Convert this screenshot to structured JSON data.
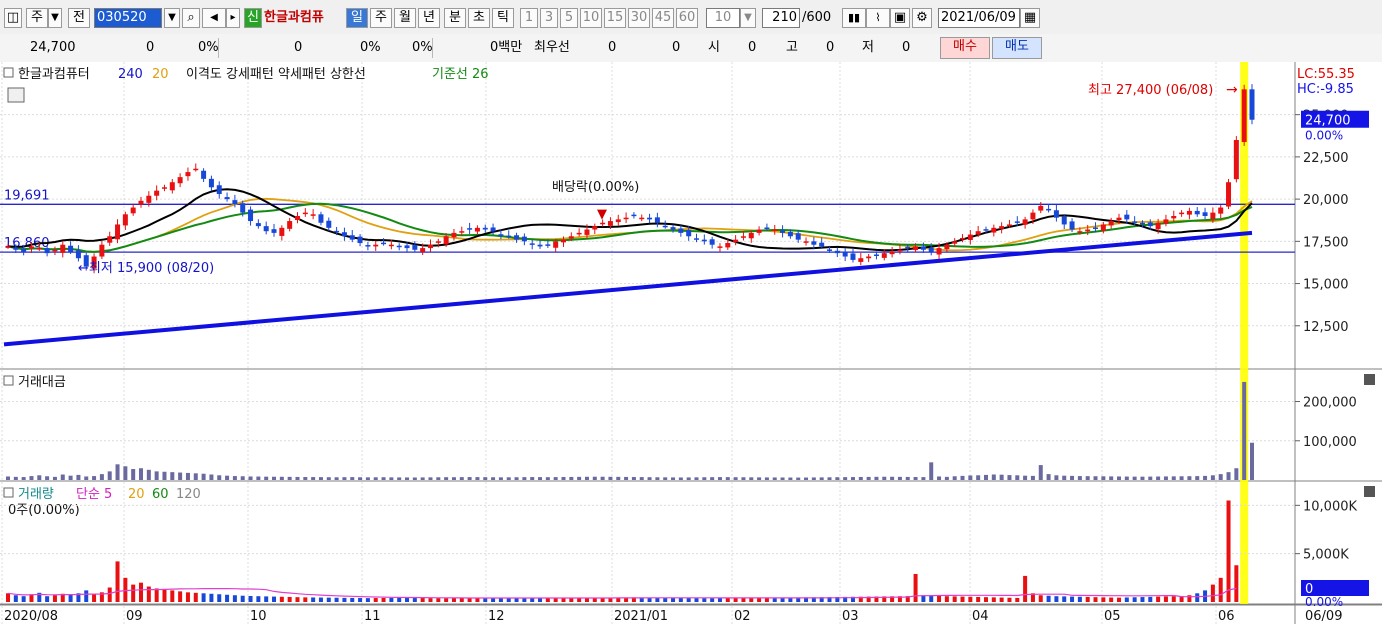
{
  "toolbar": {
    "mode_label": "주",
    "prev_label": "전",
    "code": "030520",
    "badge_label": "신",
    "stock_name": "한글과컴퓨",
    "period_tabs": [
      "일",
      "주",
      "월",
      "년",
      "분",
      "초",
      "틱"
    ],
    "active_period": "일",
    "intervals": [
      "1",
      "3",
      "5",
      "10",
      "15",
      "30",
      "45",
      "60"
    ],
    "interval_value": "10",
    "count_value": "210",
    "count_total": "/600",
    "date": "2021/06/09"
  },
  "quote": {
    "price": "24,700",
    "change": "0",
    "change_pct": "0%",
    "volume": "0",
    "vol_pct": "0%",
    "turnover_pct": "0%",
    "amount": "0백만",
    "priority_label": "최우선",
    "priority_value": "0",
    "field2": "0",
    "open_label": "시",
    "open_value": "0",
    "high_label": "고",
    "high_value": "0",
    "low_label": "저",
    "low_value": "0",
    "buy_label": "매수",
    "sell_label": "매도"
  },
  "colors": {
    "up": "#e81010",
    "down": "#1848d8",
    "ma5": "#e040d0",
    "ma20": "#e0a010",
    "ma60": "#138a13",
    "ma120": "#000000",
    "trend": "#1010e0",
    "highlight": "#ffff00",
    "price_label_bg": "#1414e6"
  },
  "chart_data": [
    {
      "type": "candlestick",
      "legend": {
        "name": "한글과컴퓨터",
        "ma1": "240",
        "ma2": "20",
        "items": "이격도 강세패턴  약세패턴  상한선",
        "base_line": "기준선 26"
      },
      "y_ticks": [
        "25,000",
        "22,500",
        "20,000",
        "17,500",
        "15,000",
        "12,500"
      ],
      "ylim": [
        10000,
        28000
      ],
      "x_ticks": [
        "2020/08",
        "09",
        "10",
        "11",
        "12",
        "2021/01",
        "02",
        "03",
        "04",
        "05",
        "06"
      ],
      "lc_label": "LC:55.35",
      "hc_label": "HC:-9.85",
      "current_price": "24,700",
      "current_value": 24700,
      "current_pct": "0.00%",
      "high_annotation": "최고 27,400 (06/08)",
      "high_value": 27400,
      "low_annotation": "최저 15,900 (08/20)",
      "low_value": 15900,
      "dividend_annotation": "배당락(0.00%)",
      "h_line_1": "19,691",
      "h_line_1_value": 19691,
      "h_line_2": "16,860",
      "h_line_2_value": 16860,
      "trend_start": 11400,
      "trend_end": 18000,
      "closes": [
        17200,
        17000,
        16900,
        17200,
        17100,
        16800,
        17000,
        17300,
        16900,
        16500,
        16000,
        16600,
        17300,
        17800,
        18500,
        19100,
        19500,
        19900,
        20200,
        20500,
        20700,
        21000,
        21300,
        21600,
        21800,
        21200,
        20700,
        20300,
        20000,
        19700,
        19200,
        18700,
        18400,
        18100,
        18000,
        18300,
        18700,
        19000,
        19200,
        19100,
        18600,
        18300,
        18100,
        17800,
        17600,
        17400,
        17200,
        17300,
        17400,
        17300,
        17200,
        17100,
        17000,
        17100,
        17300,
        17500,
        17800,
        18000,
        18100,
        18200,
        18300,
        18200,
        18100,
        17900,
        17800,
        17600,
        17500,
        17300,
        17200,
        17300,
        17500,
        17600,
        17800,
        18000,
        18200,
        18400,
        18600,
        18700,
        18800,
        18900,
        19000,
        18900,
        18800,
        18600,
        18400,
        18200,
        18000,
        17800,
        17600,
        17500,
        17300,
        17200,
        17400,
        17600,
        17800,
        18000,
        18200,
        18300,
        18200,
        18000,
        17800,
        17600,
        17500,
        17300,
        17200,
        17000,
        16800,
        16600,
        16400,
        16500,
        16600,
        16700,
        16800,
        16900,
        17000,
        17100,
        17200,
        17000,
        16900,
        17100,
        17300,
        17500,
        17700,
        17900,
        18100,
        18200,
        18300,
        18400,
        18500,
        18600,
        18800,
        19200,
        19600,
        19400,
        18900,
        18500,
        18200,
        18100,
        18200,
        18300,
        18500,
        18700,
        18900,
        18800,
        18600,
        18500,
        18400,
        18600,
        18800,
        19000,
        19200,
        19300,
        19100,
        19000,
        19200,
        19500,
        21000,
        23500,
        26500,
        24700
      ],
      "volume_panel": {
        "title": "거래대금",
        "y_ticks": [
          "200,000",
          "100,000"
        ],
        "ymax": 260000,
        "values": [
          9000,
          8000,
          7500,
          10000,
          12000,
          9500,
          8000,
          14000,
          11000,
          13000,
          9000,
          10000,
          15000,
          22000,
          40000,
          35000,
          28000,
          30000,
          26000,
          22000,
          21000,
          20000,
          19000,
          18000,
          17000,
          16000,
          14000,
          12000,
          11000,
          10000,
          9500,
          9000,
          8800,
          8500,
          8300,
          8200,
          8000,
          7800,
          7600,
          7500,
          7300,
          7100,
          7000,
          7200,
          7400,
          7000,
          6800,
          6900,
          7100,
          6700,
          6600,
          6500,
          6400,
          6600,
          6800,
          7000,
          7200,
          7100,
          7300,
          7500,
          7400,
          7200,
          7000,
          6800,
          6900,
          7100,
          7300,
          7500,
          7300,
          7200,
          7400,
          7600,
          7800,
          8000,
          8200,
          8400,
          8300,
          8100,
          8000,
          7800,
          7600,
          7400,
          7200,
          7000,
          6800,
          6600,
          6400,
          6600,
          6800,
          7000,
          7200,
          7400,
          7300,
          7100,
          7000,
          6800,
          6700,
          6600,
          6500,
          6400,
          6300,
          6200,
          6300,
          6500,
          6700,
          6900,
          7100,
          7300,
          7500,
          7700,
          7900,
          8100,
          8300,
          8200,
          8000,
          7800,
          7600,
          7400,
          45000,
          9000,
          8000,
          9500,
          10500,
          11500,
          12000,
          13000,
          14000,
          13500,
          12500,
          12000,
          11000,
          10500,
          38000,
          15000,
          12000,
          11000,
          10500,
          10000,
          9800,
          9600,
          9400,
          9200,
          9000,
          8800,
          8600,
          8500,
          8700,
          8900,
          9100,
          9300,
          9500,
          9700,
          9900,
          10500,
          12000,
          15000,
          20000,
          30000,
          250000,
          95000
        ]
      },
      "quantity_panel": {
        "title": "거래량",
        "legend": "단순 5",
        "ma_labels": [
          "20",
          "60",
          "120"
        ],
        "zero_label": "0주(0.00%)",
        "y_ticks": [
          "10,000K",
          "5,000K"
        ],
        "current_value": "0",
        "current_pct": "0.00%",
        "ymax": 12000000,
        "values": [
          900000,
          700000,
          600000,
          800000,
          950000,
          600000,
          700000,
          850000,
          750000,
          900000,
          1200000,
          800000,
          1000000,
          1500000,
          4200000,
          2500000,
          1800000,
          2000000,
          1600000,
          1400000,
          1300000,
          1200000,
          1100000,
          1000000,
          950000,
          900000,
          850000,
          800000,
          750000,
          700000,
          650000,
          620000,
          600000,
          580000,
          560000,
          540000,
          520000,
          500000,
          480000,
          470000,
          460000,
          450000,
          440000,
          430000,
          420000,
          410000,
          400000,
          410000,
          420000,
          430000,
          440000,
          430000,
          420000,
          410000,
          400000,
          390000,
          380000,
          390000,
          400000,
          410000,
          420000,
          430000,
          440000,
          450000,
          440000,
          430000,
          420000,
          410000,
          400000,
          390000,
          380000,
          390000,
          400000,
          410000,
          420000,
          430000,
          440000,
          450000,
          460000,
          470000,
          480000,
          470000,
          460000,
          450000,
          440000,
          430000,
          420000,
          410000,
          400000,
          390000,
          380000,
          370000,
          380000,
          390000,
          400000,
          410000,
          420000,
          430000,
          440000,
          450000,
          460000,
          470000,
          480000,
          490000,
          500000,
          510000,
          520000,
          530000,
          540000,
          550000,
          560000,
          570000,
          580000,
          590000,
          600000,
          610000,
          2900000,
          700000,
          650000,
          620000,
          600000,
          580000,
          560000,
          540000,
          520000,
          500000,
          480000,
          460000,
          440000,
          420000,
          2700000,
          900000,
          700000,
          650000,
          600000,
          580000,
          560000,
          540000,
          520000,
          500000,
          480000,
          460000,
          450000,
          470000,
          490000,
          510000,
          530000,
          550000,
          570000,
          590000,
          610000,
          700000,
          900000,
          1200000,
          1800000,
          2500000,
          10500000,
          3800000
        ]
      }
    }
  ]
}
